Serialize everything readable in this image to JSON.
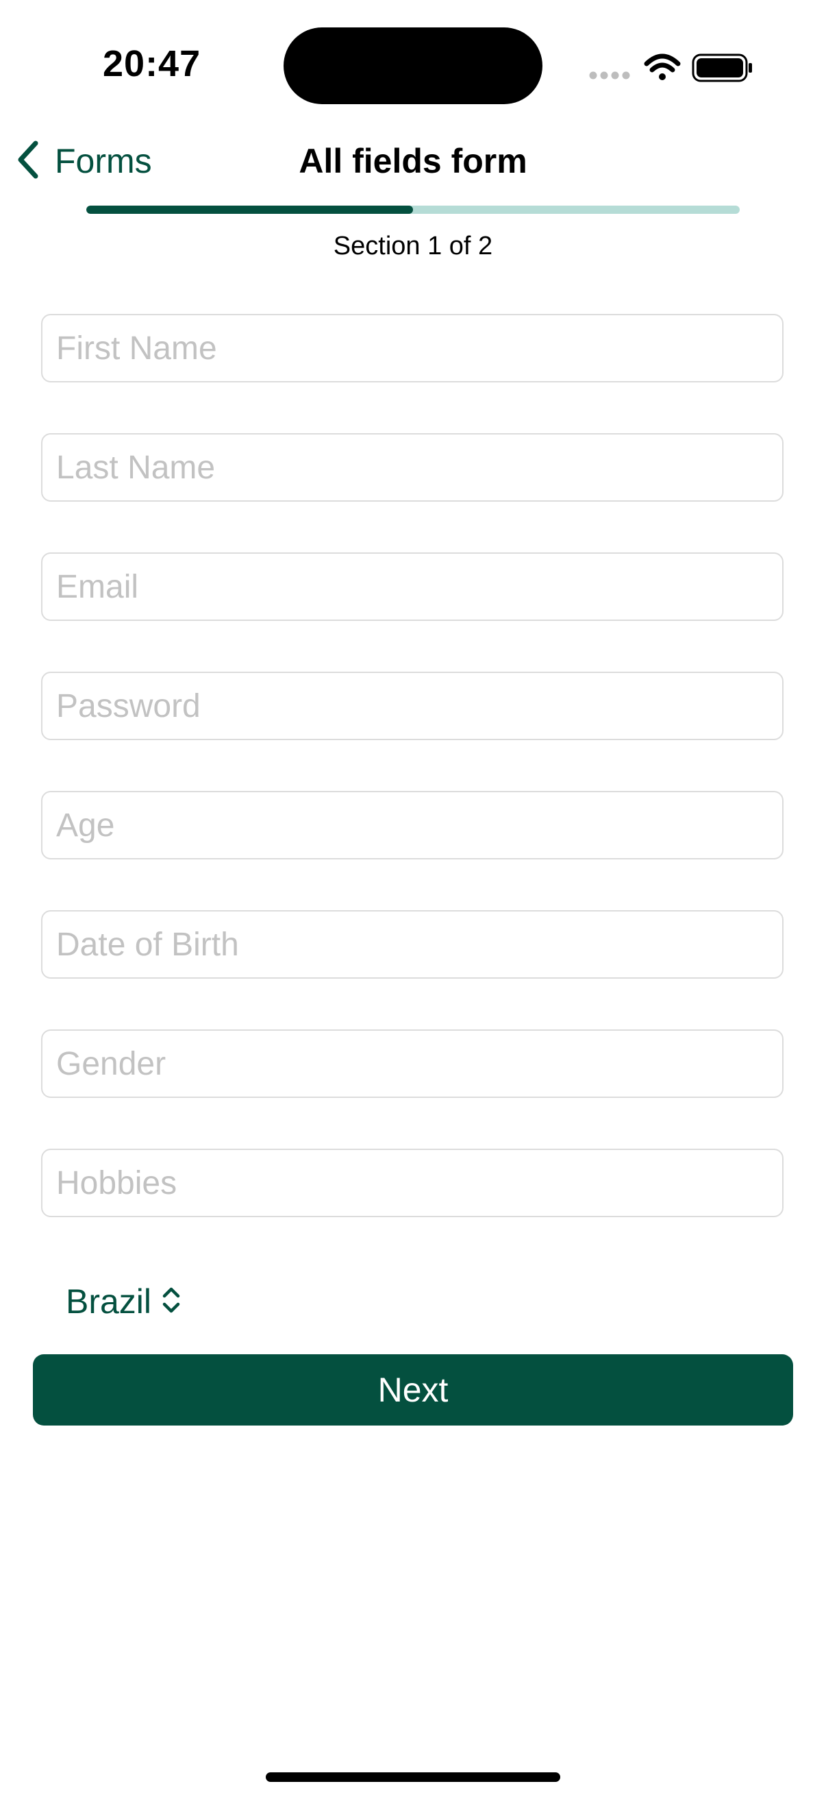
{
  "status_bar": {
    "time": "20:47",
    "icons": [
      "cellular-signal-icon",
      "wifi-icon",
      "battery-icon"
    ]
  },
  "nav": {
    "back_label": "Forms",
    "title": "All fields form"
  },
  "progress": {
    "fraction": 0.5,
    "section_label": "Section 1 of 2"
  },
  "fields": [
    {
      "placeholder": "First Name",
      "value": ""
    },
    {
      "placeholder": "Last Name",
      "value": ""
    },
    {
      "placeholder": "Email",
      "value": ""
    },
    {
      "placeholder": "Password",
      "value": ""
    },
    {
      "placeholder": "Age",
      "value": ""
    },
    {
      "placeholder": "Date of Birth",
      "value": ""
    },
    {
      "placeholder": "Gender",
      "value": ""
    },
    {
      "placeholder": "Hobbies",
      "value": ""
    }
  ],
  "country_picker": {
    "selected": "Brazil"
  },
  "next_button": {
    "label": "Next"
  },
  "colors": {
    "accent": "#04503f",
    "progress_track": "#b5dcd6",
    "placeholder": "#c2c2c2",
    "field_border": "#dcdcdc"
  }
}
